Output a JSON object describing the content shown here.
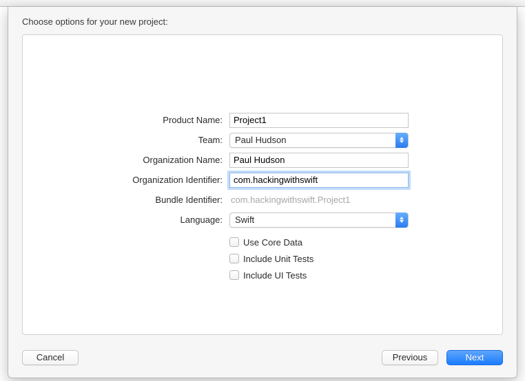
{
  "sheetTitle": "Choose options for your new project:",
  "fields": {
    "productName": {
      "label": "Product Name:",
      "value": "Project1"
    },
    "team": {
      "label": "Team:",
      "value": "Paul Hudson"
    },
    "orgName": {
      "label": "Organization Name:",
      "value": "Paul Hudson"
    },
    "orgIdentifier": {
      "label": "Organization Identifier:",
      "value": "com.hackingwithswift"
    },
    "bundleIdentifier": {
      "label": "Bundle Identifier:",
      "value": "com.hackingwithswift.Project1"
    },
    "language": {
      "label": "Language:",
      "value": "Swift"
    }
  },
  "checkboxes": {
    "coreData": "Use Core Data",
    "unitTests": "Include Unit Tests",
    "uiTests": "Include UI Tests"
  },
  "buttons": {
    "cancel": "Cancel",
    "previous": "Previous",
    "next": "Next"
  }
}
